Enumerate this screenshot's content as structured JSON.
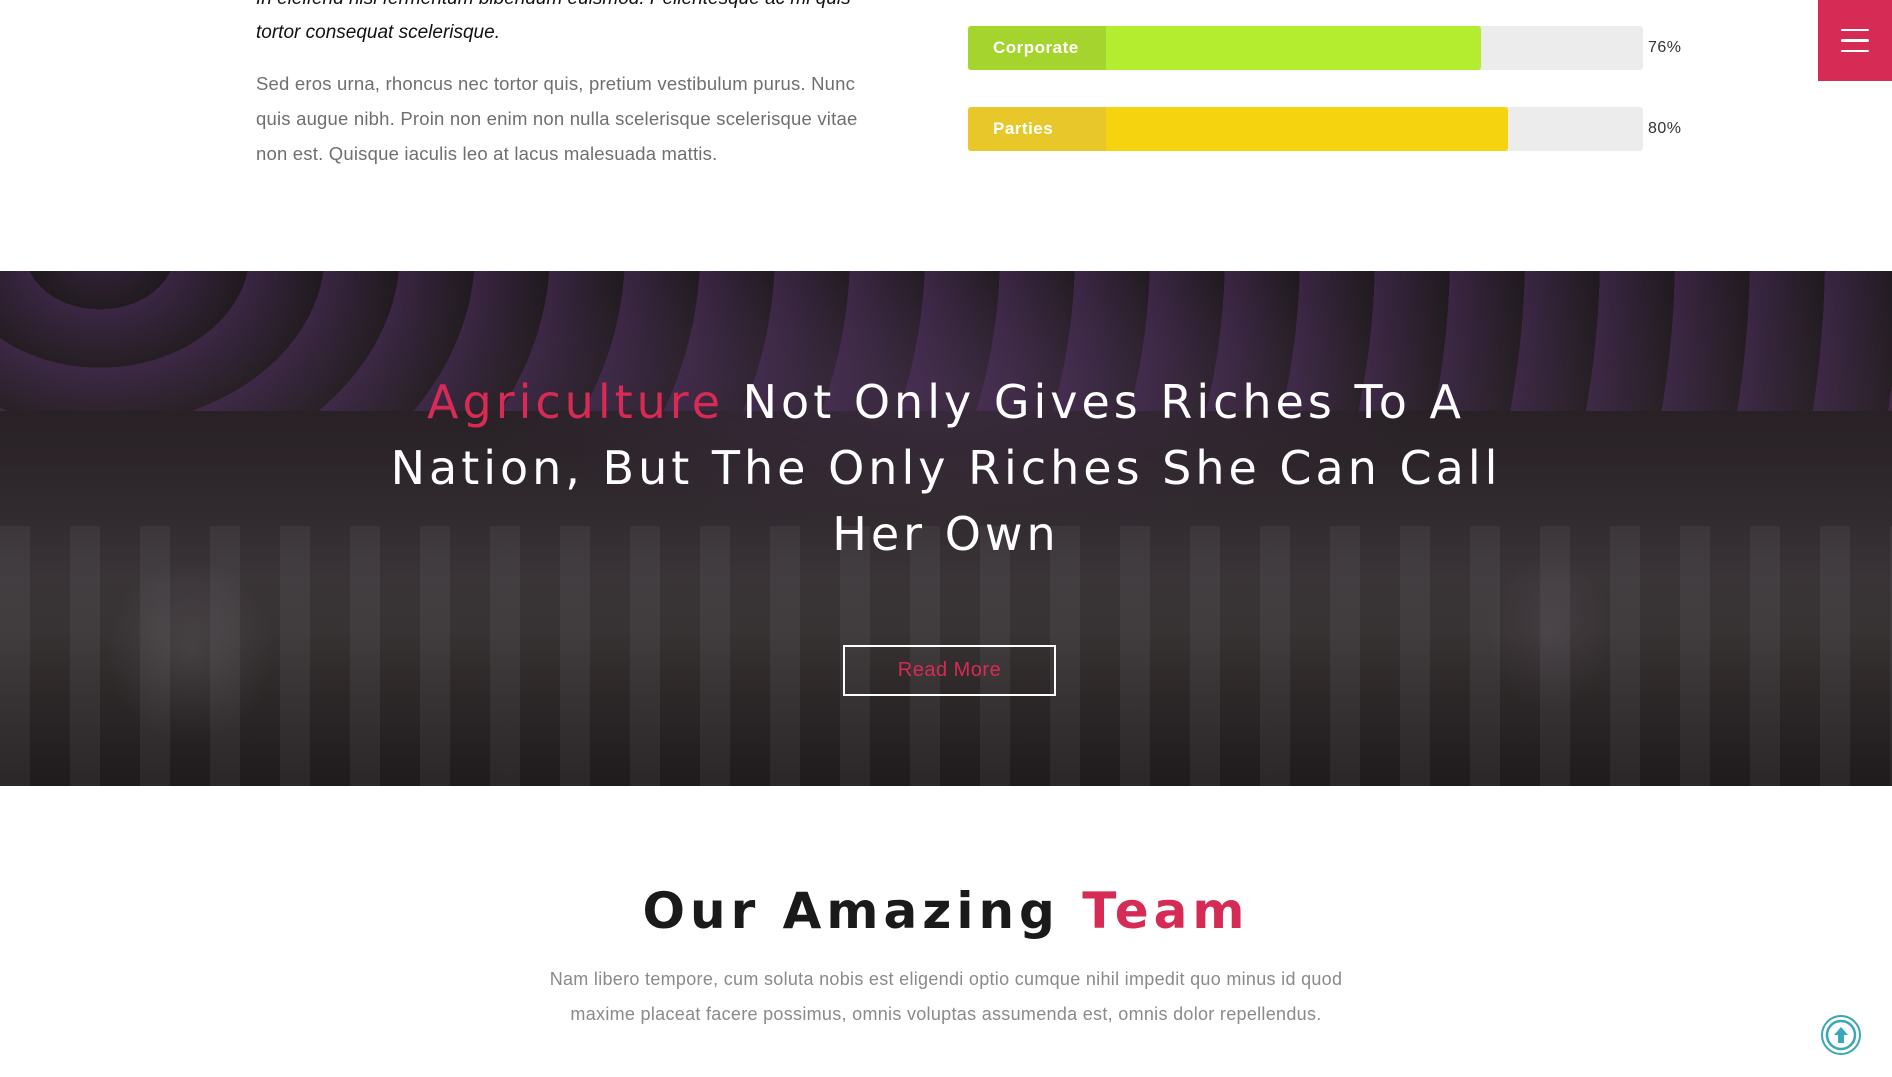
{
  "about": {
    "italic_lines": [
      "In eleifend nisi fermentum bibendum euismod. Pellentesque ac mi quis",
      "tortor consequat scelerisque."
    ],
    "body_lines": [
      "Sed eros urna, rhoncus nec tortor quis, pretium vestibulum purus. Nunc",
      "quis augue nibh. Proin non enim non nulla scelerisque scelerisque vitae",
      "non est. Quisque iaculis leo at lacus malesuada mattis."
    ]
  },
  "skills": [
    {
      "label": "Corporate",
      "percent_text": "76%",
      "value": 76,
      "label_color": "#a6d42e",
      "fill_color": "#b4ed2f"
    },
    {
      "label": "Parties",
      "percent_text": "80%",
      "value": 80,
      "label_color": "#e8c72a",
      "fill_color": "#f5d40f"
    }
  ],
  "menu": {
    "icon": "hamburger-menu-icon",
    "color": "#d62b54"
  },
  "banner": {
    "quote_accent": "Agriculture",
    "quote_rest_line1": " Not Only Gives Riches To A",
    "quote_line2": "Nation, But The Only Riches She Can Call",
    "quote_line3": "Her Own",
    "button_label": "Read More"
  },
  "team": {
    "title_main": "Our Amazing ",
    "title_accent": "Team",
    "desc_lines": [
      "Nam libero tempore, cum soluta nobis est eligendi optio cumque nihil impedit quo minus id quod",
      "maxime placeat facere possimus, omnis voluptas assumenda est, omnis dolor repellendus."
    ]
  },
  "scroll_top": {
    "icon": "arrow-up-circle-icon",
    "color": "#3aa6b9"
  },
  "accent_color": "#d62b54"
}
